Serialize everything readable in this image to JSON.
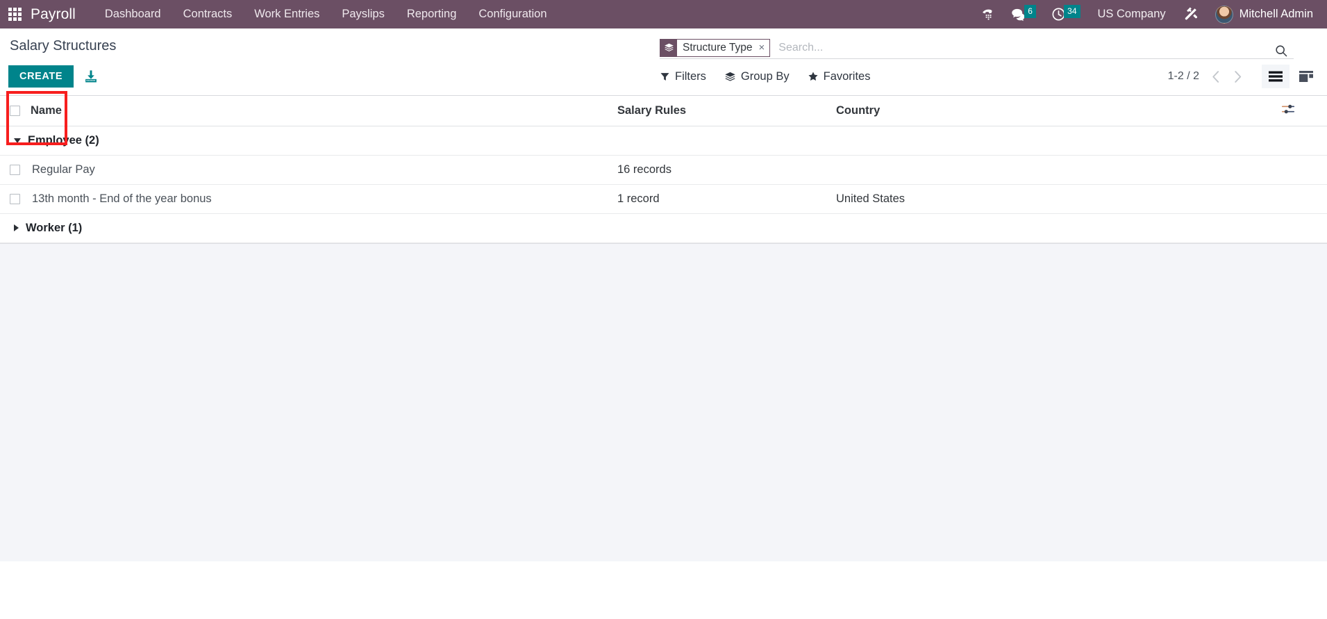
{
  "navbar": {
    "apps_icon": "apps-grid-icon",
    "brand": "Payroll",
    "menu": [
      {
        "label": "Dashboard"
      },
      {
        "label": "Contracts"
      },
      {
        "label": "Work Entries"
      },
      {
        "label": "Payslips"
      },
      {
        "label": "Reporting"
      },
      {
        "label": "Configuration"
      }
    ],
    "systray": {
      "voip_icon": "phone-dialpad-icon",
      "messages_icon": "chat-bubble-icon",
      "messages_count": "6",
      "activities_icon": "clock-icon",
      "activities_count": "34",
      "company": "US Company",
      "debug_icon": "tools-wrench-icon",
      "user_name": "Mitchell Admin",
      "avatar": "user-avatar"
    },
    "colors": {
      "background": "#6b4f64",
      "badge": "#00848b"
    }
  },
  "control_panel": {
    "breadcrumb": "Salary Structures",
    "create_label": "CREATE",
    "import_icon": "import-download-icon",
    "highlight_color": "#f71e1e",
    "create_color": "#00848b",
    "search": {
      "facet_icon": "layers-icon",
      "facet_label": "Structure Type",
      "facet_remove": "×",
      "placeholder": "Search...",
      "value": "",
      "magnifier_icon": "search-icon"
    },
    "filters": [
      {
        "label": "Filters",
        "icon": "funnel-icon"
      },
      {
        "label": "Group By",
        "icon": "layers-icon"
      },
      {
        "label": "Favorites",
        "icon": "star-icon"
      }
    ],
    "pager": {
      "range": "1-2 / 2",
      "prev_icon": "chevron-left-icon",
      "next_icon": "chevron-right-icon"
    },
    "views": [
      {
        "name": "list",
        "icon": "list-view-icon",
        "active": true
      },
      {
        "name": "kanban",
        "icon": "kanban-view-icon",
        "active": false
      }
    ]
  },
  "list": {
    "columns": [
      {
        "key": "name",
        "label": "Name"
      },
      {
        "key": "rules",
        "label": "Salary Rules"
      },
      {
        "key": "country",
        "label": "Country"
      }
    ],
    "optional_columns_icon": "sliders-icon",
    "groups": [
      {
        "label": "Employee (2)",
        "expanded": true,
        "caret": "caret-down",
        "rows": [
          {
            "name": "Regular Pay",
            "rules": "16 records",
            "country": ""
          },
          {
            "name": "13th month - End of the year bonus",
            "rules": "1 record",
            "country": "United States"
          }
        ]
      },
      {
        "label": "Worker (1)",
        "expanded": false,
        "caret": "caret-right",
        "rows": []
      }
    ]
  }
}
